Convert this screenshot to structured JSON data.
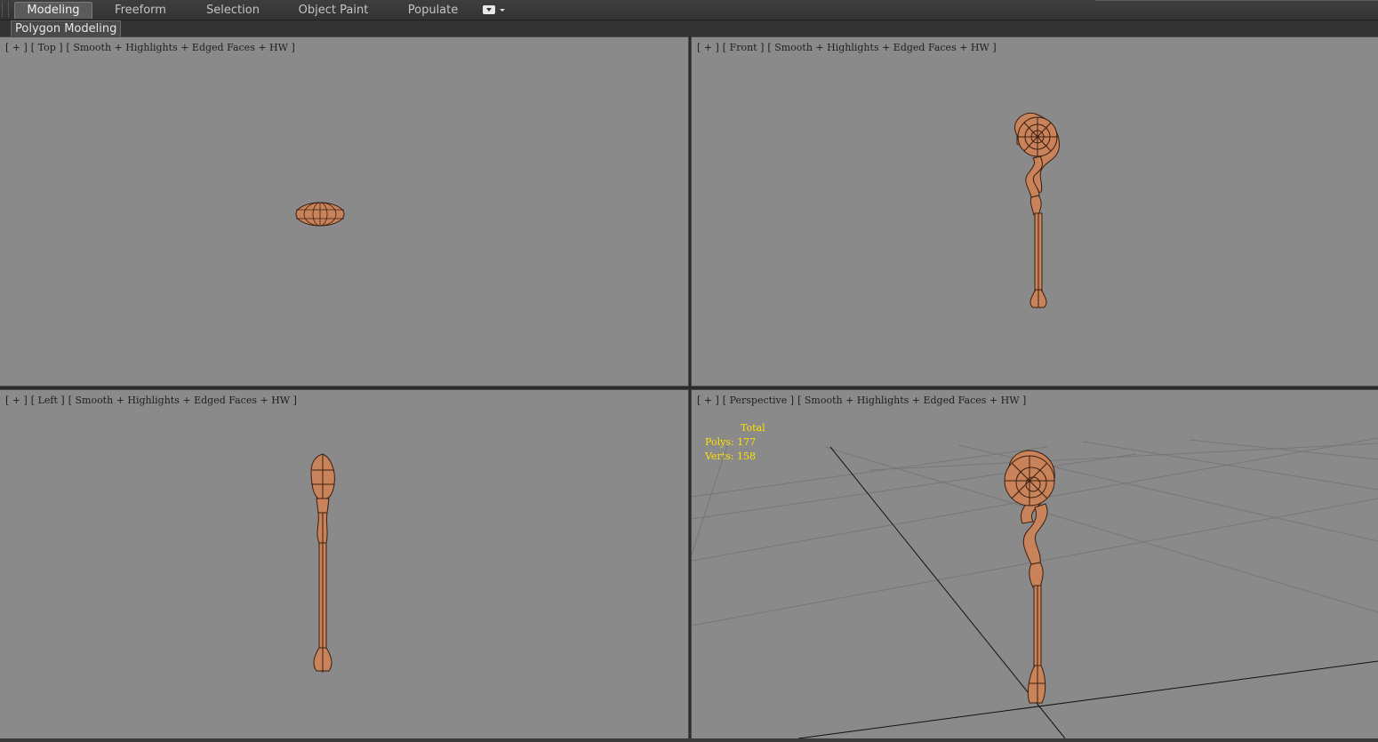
{
  "ribbon": {
    "tabs": [
      {
        "label": "Modeling",
        "active": true
      },
      {
        "label": "Freeform",
        "active": false
      },
      {
        "label": "Selection",
        "active": false
      },
      {
        "label": "Object Paint",
        "active": false
      },
      {
        "label": "Populate",
        "active": false
      }
    ],
    "options_icon": "dropdown-menu-icon",
    "panel_label": "Polygon Modeling"
  },
  "viewports": {
    "top": {
      "plus": "[ + ]",
      "view": "[ Top ]",
      "shading": "[ Smooth + Highlights + Edged Faces + HW ]"
    },
    "front": {
      "plus": "[ + ]",
      "view": "[ Front ]",
      "shading": "[ Smooth + Highlights + Edged Faces + HW ]"
    },
    "left": {
      "plus": "[ + ]",
      "view": "[ Left ]",
      "shading": "[ Smooth + Highlights + Edged Faces + HW ]"
    },
    "perspective": {
      "plus": "[ + ]",
      "view": "[ Perspective ]",
      "shading": "[ Smooth + Highlights + Edged Faces + HW ]"
    }
  },
  "stats": {
    "title": "Total",
    "polys_label": "Polys:",
    "polys": "177",
    "verts_label": "Verts:",
    "verts": "158"
  },
  "colors": {
    "viewport_bg": "#8a8a8a",
    "model": "#c8835a",
    "stats_text": "#ffe000"
  }
}
